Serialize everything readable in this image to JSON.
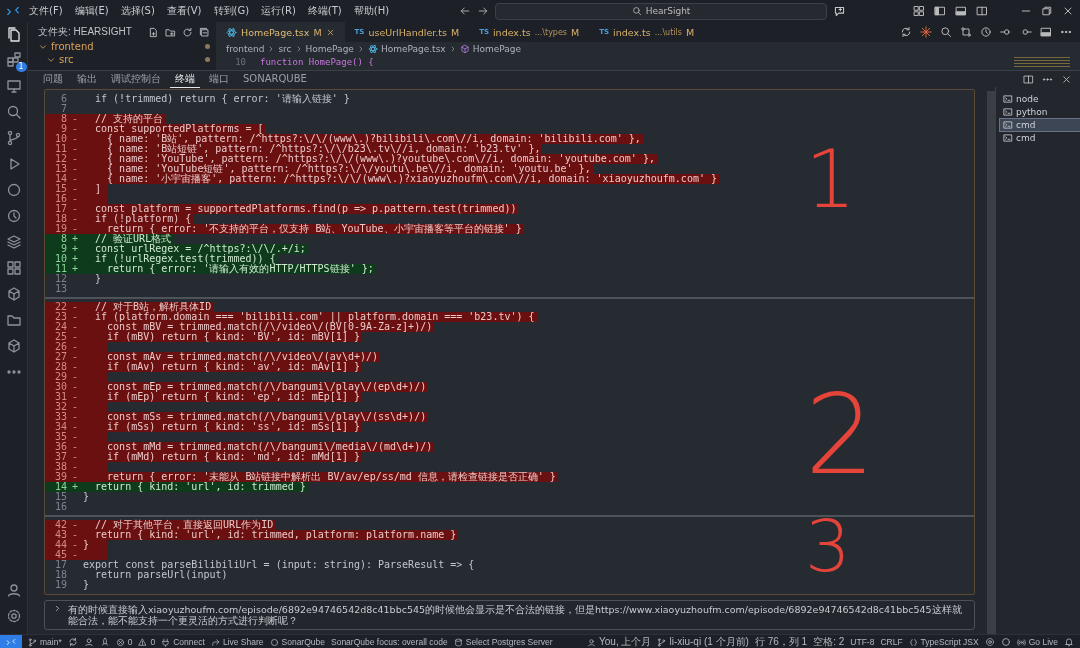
{
  "title_bar": {
    "menus": [
      "文件(F)",
      "编辑(E)",
      "选择(S)",
      "查看(V)",
      "转到(G)",
      "运行(R)",
      "终端(T)",
      "帮助(H)"
    ],
    "search": {
      "value": "HearSight"
    }
  },
  "activity_bar": {
    "badge": "1"
  },
  "explorer": {
    "title": "文件夹: HEARSIGHT",
    "tree": [
      {
        "label": "frontend",
        "expanded": true,
        "modified": true,
        "children": [
          {
            "label": "src",
            "expanded": true,
            "modified": true
          }
        ]
      }
    ]
  },
  "editor": {
    "tabs": [
      {
        "label": "HomePage.tsx",
        "status": "M",
        "kind": "tsx",
        "selected": true
      },
      {
        "label": "useUrlHandler.ts",
        "status": "M",
        "kind": "ts",
        "icon_text": "TS",
        "selected": false
      },
      {
        "label": "index.ts",
        "detail": "...\\types",
        "status": "M",
        "kind": "ts",
        "icon_text": "TS",
        "selected": false
      },
      {
        "label": "index.ts",
        "detail": "...\\utils",
        "status": "M",
        "kind": "ts",
        "icon_text": "TS",
        "selected": false
      }
    ],
    "breadcrumb": [
      {
        "label": "frontend",
        "kind": "folder"
      },
      {
        "label": "src",
        "kind": "folder"
      },
      {
        "label": "HomePage",
        "kind": "folder"
      },
      {
        "label": "HomePage.tsx",
        "kind": "tsx"
      },
      {
        "label": "HomePage",
        "kind": "component"
      }
    ],
    "line": {
      "number": "10",
      "text": "function HomePage() {"
    }
  },
  "panel": {
    "tabs": [
      {
        "label": "问题",
        "selected": false
      },
      {
        "label": "输出",
        "selected": false
      },
      {
        "label": "调试控制台",
        "selected": false
      },
      {
        "label": "终端",
        "selected": true
      },
      {
        "label": "端口",
        "selected": false
      },
      {
        "label": "SONARQUBE",
        "selected": false
      }
    ],
    "terminals": [
      {
        "label": "node",
        "selected": false
      },
      {
        "label": "python",
        "selected": false
      },
      {
        "label": "cmd",
        "selected": true
      },
      {
        "label": "cmd",
        "selected": false
      }
    ],
    "diff_sections": [
      [
        {
          "number": "6",
          "kind": "context",
          "text": "  if (!trimmed) return { error: '请输入链接' }"
        },
        {
          "number": "7",
          "kind": "context"
        },
        {
          "number": "8",
          "kind": "removed",
          "sign": "-",
          "text": "  // 支持的平台"
        },
        {
          "number": "9",
          "kind": "removed",
          "sign": "-",
          "text": "  const supportedPlatforms = ["
        },
        {
          "number": "10",
          "kind": "removed",
          "sign": "-",
          "text": "    { name: 'B站', pattern: /^https?:\\/\\/(www\\.)?bilibili\\.com\\//i, domain: 'bilibili.com' },"
        },
        {
          "number": "11",
          "kind": "removed",
          "sign": "-",
          "text": "    { name: 'B站短链', pattern: /^https?:\\/\\/b23\\.tv\\//i, domain: 'b23.tv' },"
        },
        {
          "number": "12",
          "kind": "removed",
          "sign": "-",
          "text": "    { name: 'YouTube', pattern: /^https?:\\/\\/(www\\.)?youtube\\.com\\//i, domain: 'youtube.com' },"
        },
        {
          "number": "13",
          "kind": "removed",
          "sign": "-",
          "text": "    { name: 'YouTube短链', pattern: /^https?:\\/\\/youtu\\.be\\//i, domain: 'youtu.be' },"
        },
        {
          "number": "14",
          "kind": "removed",
          "sign": "-",
          "text": "    { name: '小宇宙播客', pattern: /^https?:\\/\\/(www\\.)?xiaoyuzhoufm\\.com\\//i, domain: 'xiaoyuzhoufm.com' }"
        },
        {
          "number": "15",
          "kind": "removed",
          "sign": "-",
          "text": "  ]"
        },
        {
          "number": "16",
          "kind": "removed",
          "sign": "-"
        },
        {
          "number": "17",
          "kind": "removed",
          "sign": "-",
          "text": "  const platform = supportedPlatforms.find(p => p.pattern.test(trimmed))"
        },
        {
          "number": "18",
          "kind": "removed",
          "sign": "-",
          "text": "  if (!platform) {"
        },
        {
          "number": "19",
          "kind": "removed",
          "sign": "-",
          "text": "    return { error: '不支持的平台，仅支持 B站、YouTube、小宇宙播客等平台的链接' }"
        },
        {
          "number": "8",
          "kind": "added",
          "sign": "+",
          "text": "  // 验证URL格式"
        },
        {
          "number": "9",
          "kind": "added",
          "sign": "+",
          "text": "  const urlRegex = /^https?:\\/\\/.+/i;"
        },
        {
          "number": "10",
          "kind": "added",
          "sign": "+",
          "text": "  if (!urlRegex.test(trimmed)) {"
        },
        {
          "number": "11",
          "kind": "added",
          "sign": "+",
          "text": "    return { error: '请输入有效的HTTP/HTTPS链接' };"
        },
        {
          "number": "12",
          "kind": "context",
          "text": "  }"
        },
        {
          "number": "13",
          "kind": "context"
        }
      ],
      [
        {
          "number": "22",
          "kind": "removed",
          "sign": "-",
          "text": "  // 对于B站，解析具体ID"
        },
        {
          "number": "23",
          "kind": "removed",
          "sign": "-",
          "text": "  if (platform.domain === 'bilibili.com' || platform.domain === 'b23.tv') {"
        },
        {
          "number": "24",
          "kind": "removed",
          "sign": "-",
          "text": "    const mBV = trimmed.match(/\\/video\\/(BV[0-9A-Za-z]+)/)"
        },
        {
          "number": "25",
          "kind": "removed",
          "sign": "-",
          "text": "    if (mBV) return { kind: 'BV', id: mBV[1] }"
        },
        {
          "number": "26",
          "kind": "removed",
          "sign": "-"
        },
        {
          "number": "27",
          "kind": "removed",
          "sign": "-",
          "text": "    const mAv = trimmed.match(/\\/video\\/(av\\d+)/)"
        },
        {
          "number": "28",
          "kind": "removed",
          "sign": "-",
          "text": "    if (mAv) return { kind: 'av', id: mAv[1] }"
        },
        {
          "number": "29",
          "kind": "removed",
          "sign": "-"
        },
        {
          "number": "30",
          "kind": "removed",
          "sign": "-",
          "text": "    const mEp = trimmed.match(/\\/bangumi\\/play\\/(ep\\d+)/)"
        },
        {
          "number": "31",
          "kind": "removed",
          "sign": "-",
          "text": "    if (mEp) return { kind: 'ep', id: mEp[1] }"
        },
        {
          "number": "32",
          "kind": "removed",
          "sign": "-"
        },
        {
          "number": "33",
          "kind": "removed",
          "sign": "-",
          "text": "    const mSs = trimmed.match(/\\/bangumi\\/play\\/(ss\\d+)/)"
        },
        {
          "number": "34",
          "kind": "removed",
          "sign": "-",
          "text": "    if (mSs) return { kind: 'ss', id: mSs[1] }"
        },
        {
          "number": "35",
          "kind": "removed",
          "sign": "-"
        },
        {
          "number": "36",
          "kind": "removed",
          "sign": "-",
          "text": "    const mMd = trimmed.match(/\\/bangumi\\/media\\/(md\\d+)/)"
        },
        {
          "number": "37",
          "kind": "removed",
          "sign": "-",
          "text": "    if (mMd) return { kind: 'md', id: mMd[1] }"
        },
        {
          "number": "38",
          "kind": "removed",
          "sign": "-"
        },
        {
          "number": "39",
          "kind": "removed",
          "sign": "-",
          "text": "    return { error: '未能从 B站链接中解析出 BV/av/ep/ss/md 信息，请检查链接是否正确' }"
        },
        {
          "number": "14",
          "kind": "added",
          "sign": "+",
          "text": "  return { kind: 'url', id: trimmed }"
        },
        {
          "number": "15",
          "kind": "context",
          "text": "}"
        },
        {
          "number": "16",
          "kind": "context"
        }
      ],
      [
        {
          "number": "42",
          "kind": "removed",
          "sign": "-",
          "text": "  // 对于其他平台，直接返回URL作为ID"
        },
        {
          "number": "43",
          "kind": "removed",
          "sign": "-",
          "text": "  return { kind: 'url', id: trimmed, platform: platform.name }"
        },
        {
          "number": "44",
          "kind": "removed",
          "sign": "-",
          "text": "}"
        },
        {
          "number": "45",
          "kind": "removed",
          "sign": "-"
        },
        {
          "number": "17",
          "kind": "context",
          "text": "export const parseBilibiliUrl = (input: string): ParseResult => {"
        },
        {
          "number": "18",
          "kind": "context",
          "text": "  return parseUrl(input)"
        },
        {
          "number": "19",
          "kind": "context",
          "text": "}"
        }
      ]
    ],
    "annotations": [
      "1",
      "2",
      "3"
    ],
    "prompt": {
      "value": "有的时候直接输入xiaoyuzhoufm.com/episode/6892e94746542d8c41bbc545的时候他会显示是不合法的链接，但是https://www.xiaoyuzhoufm.com/episode/6892e94746542d8c41bbc545这样就能合法，能不能支持一个更灵活的方式进行判断呢？"
    }
  },
  "status_bar": {
    "left": [
      {
        "kind": "branch",
        "text": "main*"
      },
      {
        "kind": "sync"
      },
      {
        "kind": "person"
      },
      {
        "kind": "rocket"
      },
      {
        "kind": "error",
        "text": "0"
      },
      {
        "kind": "warning",
        "text": "0"
      },
      {
        "kind": "plug",
        "text": "Connect"
      },
      {
        "kind": "share",
        "text": "Live Share"
      },
      {
        "kind": "circle",
        "text": "SonarQube"
      },
      {
        "kind": "plain",
        "text": "SonarQube focus: overall code"
      },
      {
        "kind": "database",
        "text": "Select Postgres Server"
      }
    ],
    "right": [
      {
        "kind": "person",
        "text": "You, 上个月"
      },
      {
        "kind": "branch",
        "text": "li-xiu-qi (1 个月前)"
      },
      {
        "kind": "plain",
        "text": "行 76，列 1"
      },
      {
        "kind": "plain",
        "text": "空格: 2"
      },
      {
        "kind": "plain",
        "text": "UTF-8"
      },
      {
        "kind": "plain",
        "text": "CRLF"
      },
      {
        "kind": "braces",
        "text": "TypeScript JSX"
      },
      {
        "kind": "gear"
      },
      {
        "kind": "circle"
      },
      {
        "kind": "broadcast",
        "text": "Go Live"
      },
      {
        "kind": "bell"
      }
    ]
  }
}
